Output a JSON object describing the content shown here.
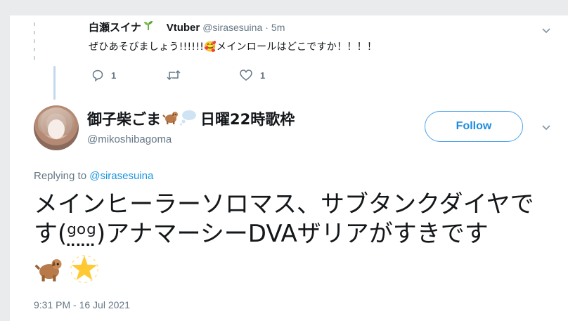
{
  "parent_tweet": {
    "name": "白瀬スイナ",
    "name_emoji": "sprout-icon",
    "tag": "Vtuber",
    "handle": "@sirasesuina",
    "separator": "·",
    "time": "5m",
    "text": "ぜひあそびましょう!!!!!!🥰メインロールはどこですか！！！！",
    "reply_count": "1",
    "retweet_count": "",
    "like_count": "1"
  },
  "main_tweet": {
    "display_name": "御子柴ごま",
    "display_name_suffix": "日曜22時歌枠",
    "handle": "@mikoshibagoma",
    "follow_label": "Follow",
    "replying_prefix": "Replying to",
    "replying_to": "@sirasesuina",
    "text": "メインヒーラーソロマス、サブタンクダイヤです(ᵍ̤ᵒ̤ᵍ̤)アナマーシーDVAザリアがすきです",
    "timestamp": "9:31 PM - 16 Jul 2021"
  },
  "colors": {
    "accent": "#1b95e0",
    "text": "#14171a",
    "muted": "#657786",
    "thread_line": "#c2d8ef"
  }
}
